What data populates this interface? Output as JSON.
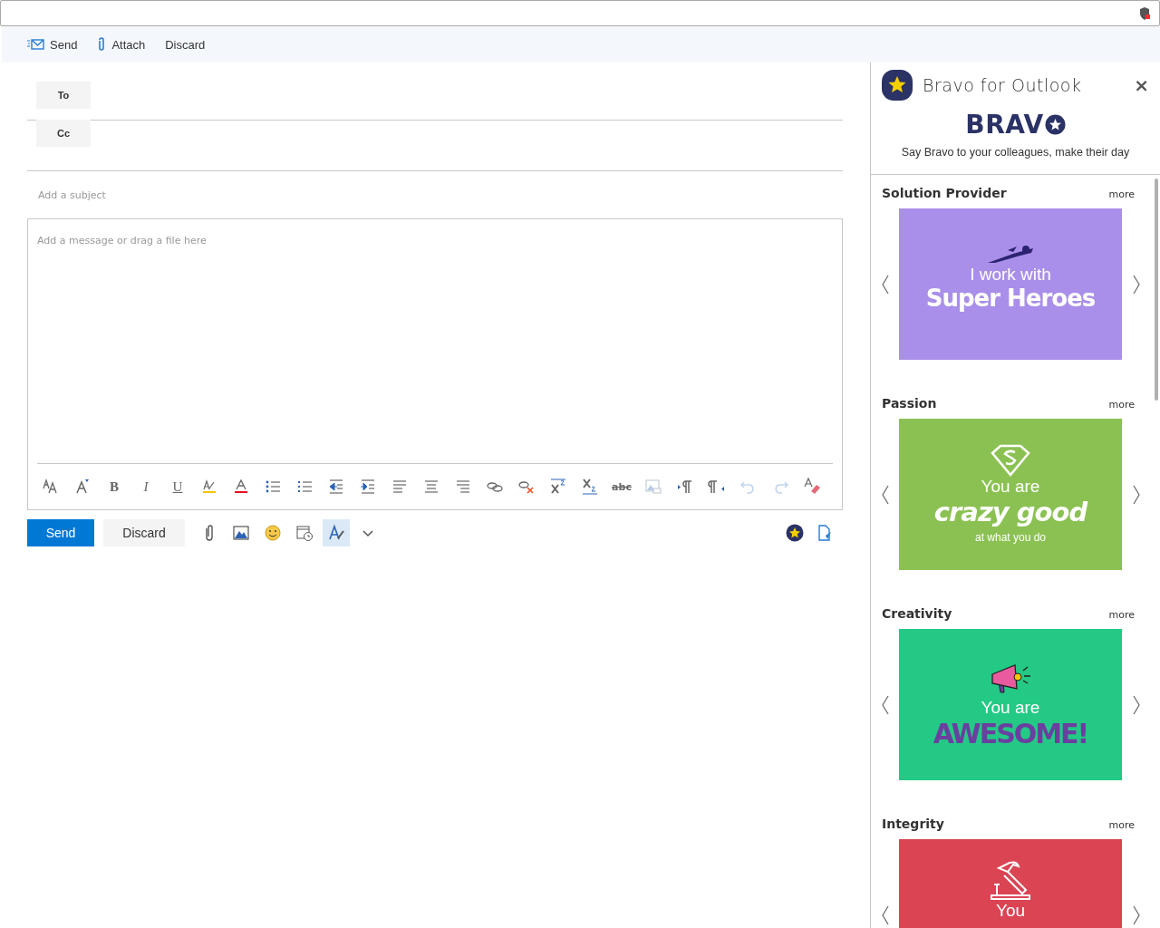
{
  "command_bar": [
    {
      "kind": "send",
      "label": "Send"
    },
    {
      "kind": "attach",
      "label": "Attach"
    },
    {
      "kind": "plain",
      "label": "Discard"
    }
  ],
  "recipients": [
    {
      "label": "To"
    },
    {
      "label": "Cc"
    }
  ],
  "subject": {
    "placeholder": "Add a subject"
  },
  "body": {
    "placeholder": "Add a message or drag a file here"
  },
  "format_toolbar": [
    {
      "kind": "font",
      "disabled": false
    },
    {
      "kind": "grow",
      "disabled": false
    },
    {
      "kind": "bold",
      "glyph": "B",
      "disabled": false
    },
    {
      "kind": "italic",
      "glyph": "I",
      "disabled": false
    },
    {
      "kind": "underline",
      "glyph": "U",
      "disabled": false
    },
    {
      "kind": "highlight",
      "disabled": false
    },
    {
      "kind": "fontcolor",
      "disabled": false
    },
    {
      "kind": "bullets",
      "disabled": false
    },
    {
      "kind": "numbers",
      "disabled": false
    },
    {
      "kind": "outdent",
      "disabled": false
    },
    {
      "kind": "indent",
      "disabled": false
    },
    {
      "kind": "align-left",
      "disabled": false
    },
    {
      "kind": "align-center",
      "disabled": false
    },
    {
      "kind": "align-right",
      "disabled": false
    },
    {
      "kind": "link",
      "disabled": false
    },
    {
      "kind": "unlink",
      "disabled": false
    },
    {
      "kind": "superscript",
      "disabled": false
    },
    {
      "kind": "subscript",
      "disabled": false
    },
    {
      "kind": "strike",
      "glyph": "abc",
      "disabled": false
    },
    {
      "kind": "picture",
      "disabled": true
    },
    {
      "kind": "ltr",
      "disabled": false
    },
    {
      "kind": "rtl",
      "disabled": false
    },
    {
      "kind": "undo",
      "disabled": true
    },
    {
      "kind": "redo",
      "disabled": true
    },
    {
      "kind": "clear",
      "disabled": false
    }
  ],
  "actions": {
    "send": "Send",
    "discard": "Discard",
    "tools": [
      {
        "kind": "attach",
        "selected": false
      },
      {
        "kind": "image",
        "selected": false
      },
      {
        "kind": "emoji",
        "selected": false
      },
      {
        "kind": "schedule",
        "selected": false
      },
      {
        "kind": "format",
        "selected": true
      },
      {
        "kind": "more",
        "selected": false
      }
    ],
    "right_tools": [
      {
        "kind": "bravo"
      },
      {
        "kind": "doc"
      }
    ]
  },
  "addin": {
    "title": "Bravo for Outlook",
    "close": "×",
    "logo": "BRAV",
    "tagline": "Say Bravo to your colleagues, make their day",
    "sections": [
      {
        "title": "Solution Provider",
        "more": "more",
        "kind": "hero",
        "color": "#a98fe9",
        "lines": [
          "I work with",
          "Super Heroes"
        ]
      },
      {
        "title": "Passion",
        "more": "more",
        "kind": "shield",
        "color": "#8bc152",
        "lines": [
          "You are",
          "crazy good",
          "at what you do"
        ]
      },
      {
        "title": "Creativity",
        "more": "more",
        "kind": "megaphone",
        "color": "#24c985",
        "lines": [
          "You are",
          "AWESOME!"
        ]
      },
      {
        "title": "Integrity",
        "more": "more",
        "kind": "hammer",
        "color": "#da4453",
        "lines": [
          "You"
        ]
      }
    ]
  }
}
